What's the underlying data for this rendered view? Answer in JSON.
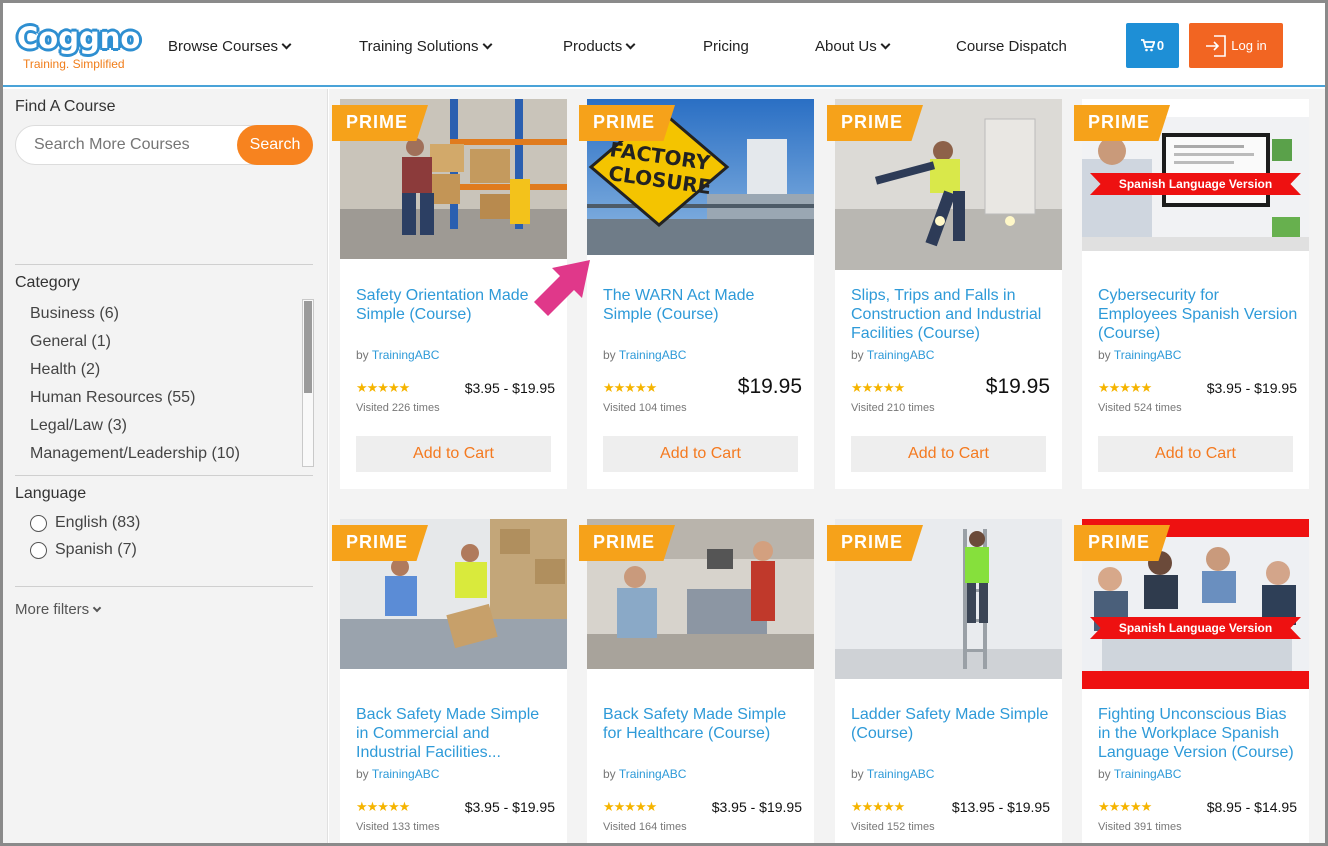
{
  "brand": {
    "name": "Coggno",
    "tagline": "Training. Simplified"
  },
  "nav": [
    {
      "label": "Browse Courses",
      "dropdown": true
    },
    {
      "label": "Training Solutions",
      "dropdown": true
    },
    {
      "label": "Products",
      "dropdown": true
    },
    {
      "label": "Pricing",
      "dropdown": false
    },
    {
      "label": "About Us",
      "dropdown": true
    },
    {
      "label": "Course Dispatch",
      "dropdown": false
    }
  ],
  "cart": {
    "count": "0"
  },
  "login": {
    "label": "Log in"
  },
  "sidebar": {
    "find_heading": "Find A Course",
    "search_placeholder": "Search More Courses",
    "search_button": "Search",
    "category_heading": "Category",
    "categories": [
      "Business (6)",
      "General (1)",
      "Health (2)",
      "Human Resources (55)",
      "Legal/Law (3)",
      "Management/Leadership (10)"
    ],
    "language_heading": "Language",
    "languages": [
      "English (83)",
      "Spanish (7)"
    ],
    "more_filters": "More filters"
  },
  "badge": "PRIME",
  "spanish_banner": "Spanish Language Version",
  "by_prefix": "by",
  "add_to_cart": "Add to Cart",
  "stars": "★★★★★",
  "courses": [
    {
      "title": "Safety Orientation Made Simple (Course)",
      "author": "TrainingABC",
      "price": "$3.95 - $19.95",
      "visited": "Visited 226 times"
    },
    {
      "title": "The WARN Act Made Simple (Course)",
      "author": "TrainingABC",
      "price": "$19.95",
      "visited": "Visited 104 times"
    },
    {
      "title": "Slips, Trips and Falls in Construction and Industrial Facilities (Course)",
      "author": "TrainingABC",
      "price": "$19.95",
      "visited": "Visited 210 times"
    },
    {
      "title": "Cybersecurity for Employees Spanish Version (Course)",
      "author": "TrainingABC",
      "price": "$3.95 - $19.95",
      "visited": "Visited 524 times"
    },
    {
      "title": "Back Safety Made Simple in Commercial and Industrial Facilities...",
      "author": "TrainingABC",
      "price": "$3.95 - $19.95",
      "visited": "Visited 133 times"
    },
    {
      "title": "Back Safety Made Simple for Healthcare (Course)",
      "author": "TrainingABC",
      "price": "$3.95 - $19.95",
      "visited": "Visited 164 times"
    },
    {
      "title": "Ladder Safety Made Simple (Course)",
      "author": "TrainingABC",
      "price": "$13.95 - $19.95",
      "visited": "Visited 152 times"
    },
    {
      "title": "Fighting Unconscious Bias in the Workplace Spanish Language Version (Course)",
      "author": "TrainingABC",
      "price": "$8.95 - $14.95",
      "visited": "Visited 391 times"
    }
  ],
  "factory_sign": "FACTORY CLOSURE",
  "colors": {
    "accent_blue": "#2e9ad8",
    "orange": "#f7831f",
    "prime": "#f6a21a",
    "login": "#f26522",
    "cart": "#1e8fd6"
  }
}
